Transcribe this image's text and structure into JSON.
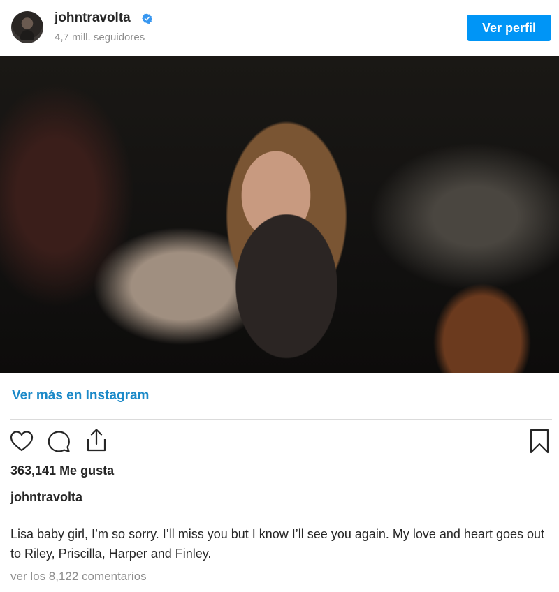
{
  "header": {
    "username": "johntravolta",
    "followers": "4,7 mill. seguidores",
    "view_profile_label": "Ver perfil",
    "verified_icon": "verified-badge-icon",
    "verified_color": "#3897f0"
  },
  "post": {
    "image_icon": "post-photo",
    "view_more_label": "Ver más en Instagram",
    "likes": "363,141 Me gusta",
    "caption_user": "johntravolta",
    "caption": "Lisa baby girl, I’m so sorry. I’ll miss you but I know I’ll see you again. My love and heart goes out to Riley, Priscilla, Harper and Finley.",
    "view_comments": "ver los 8,122 comentarios"
  },
  "actions": {
    "like_icon": "heart-icon",
    "comment_icon": "comment-icon",
    "share_icon": "share-icon",
    "save_icon": "bookmark-icon"
  },
  "colors": {
    "accent": "#0095f6",
    "link": "#1b89c8",
    "muted": "#8e8e8e"
  }
}
